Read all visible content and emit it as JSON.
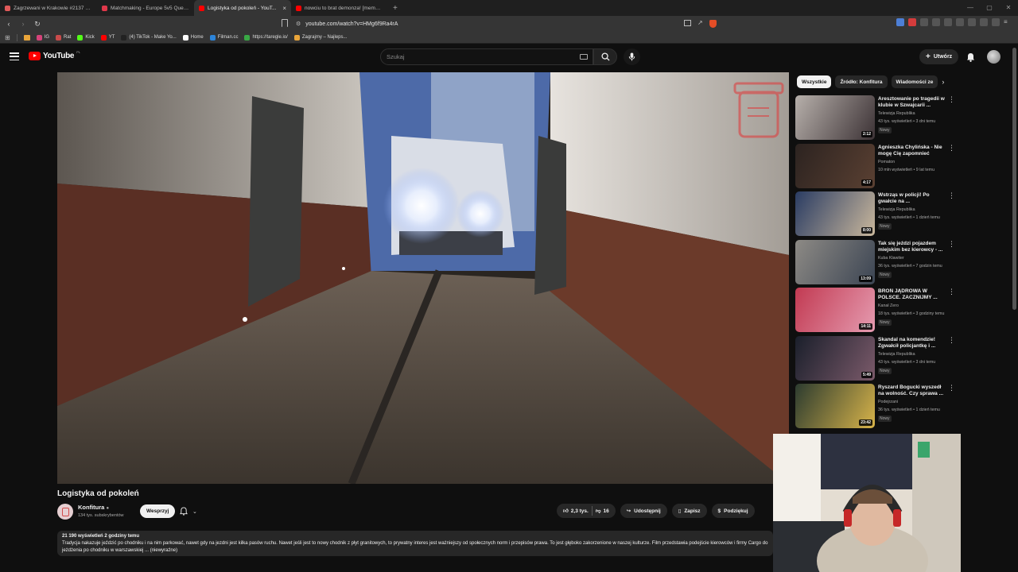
{
  "browser": {
    "tabs": [
      {
        "title": "Zagrzewani w Krakowie #2137 Wa...",
        "favicon_color": "#e05a5a",
        "active": false
      },
      {
        "title": "Matchmaking - Europe 5v5 Queue -",
        "favicon_color": "#e0384a",
        "active": false
      },
      {
        "title": "Logistyka od pokoleń - YouT...",
        "favicon_color": "#ff0000",
        "active": true
      },
      {
        "title": "nowciu to brat demonza! [memmor...",
        "favicon_color": "#ff0000",
        "active": false
      }
    ],
    "url": "youtube.com/watch?v=HMg6f9Ra4rA",
    "bookmarks": [
      {
        "label": "IG",
        "color": "#d6437a"
      },
      {
        "label": "Rat",
        "color": "#c94b4b"
      },
      {
        "label": "Kick",
        "color": "#53fc18"
      },
      {
        "label": "YT",
        "color": "#ff0000"
      },
      {
        "label": "(4) TikTok - Make Yo...",
        "color": "#222222"
      },
      {
        "label": "Home",
        "color": "#ffffff"
      },
      {
        "label": "Filman.cc",
        "color": "#2c84d9"
      },
      {
        "label": "https://taregle.io/",
        "color": "#39a845"
      },
      {
        "label": "Zagrajmy – Najleps...",
        "color": "#e9a53a"
      }
    ]
  },
  "youtube": {
    "logo_text": "YouTube",
    "logo_country": "PL",
    "search_placeholder": "Szukaj",
    "create_label": "Utwórz"
  },
  "video": {
    "title": "Logistyka od pokoleń",
    "channel": "Konfitura",
    "subscribers": "134 tys. subskrybentów",
    "support_label": "Wesprzyj",
    "likes": "2,3 tys.",
    "dislikes": "16",
    "share_label": "Udostępnij",
    "save_label": "Zapisz",
    "thanks_label": "Podziękuj",
    "views_time": "21 190 wyświetleń  2 godziny temu",
    "description": "Tradycja nakazuje jeździć po chodniku i na nim parkować, nawet gdy na jezdni jest kilka pasów ruchu. Nawet jeśli jest to nowy chodnik z płyt granitowych, to prywatny interes jest ważniejszy od społecznych norm i przepisów prawa. To jest głęboko zakorzenione w naszej kulturze. Film przedstawia podejście kierowców i firmy Cargo do jeżdżenia po chodniku w warszawskiej ... (niewyraźne)"
  },
  "chips": [
    "Wszystkie",
    "Źródło: Konfitura",
    "Wiadomości ze"
  ],
  "recommendations": [
    {
      "title": "Aresztowanie po tragedii w klubie w Szwajcarii ...",
      "channel": "Telewizja Republika",
      "meta": "43 tys. wyświetleń • 3 dni temu",
      "badge": "Nowy",
      "duration": "2:12",
      "colors": [
        "#b7b0ab",
        "#3c3235"
      ]
    },
    {
      "title": "Agnieszka Chylińska - Nie mogę Cię zapomnieć",
      "channel": "Pomaton",
      "meta": "10 mln wyświetleń • 9 lat temu",
      "badge": "",
      "duration": "4:17",
      "colors": [
        "#2c2320",
        "#5a4032"
      ]
    },
    {
      "title": "Wstrząs w policji! Po gwałcie na ...",
      "channel": "Telewizja Republika",
      "meta": "43 tys. wyświetleń • 1 dzień temu",
      "badge": "Nowy",
      "duration": "8:00",
      "colors": [
        "#2a3c63",
        "#c9b79c"
      ]
    },
    {
      "title": "Tak się jeździ pojazdem miejskim bez kierowcy - ...",
      "channel": "Kuba Klawiter",
      "meta": "36 tys. wyświetleń • 7 godzin temu",
      "badge": "Nowy",
      "duration": "13:09",
      "colors": [
        "#8d8a85",
        "#3c4553"
      ]
    },
    {
      "title": "BROŃ JĄDROWA W POLSCE. ZACZNIJMY ...",
      "channel": "Kanał Zero",
      "meta": "18 tys. wyświetleń • 3 godziny temu",
      "badge": "Nowy",
      "duration": "14:11",
      "colors": [
        "#c23a52",
        "#e59bb0"
      ]
    },
    {
      "title": "Skandal na komendzie! Zgwałcił policjantkę i ...",
      "channel": "Telewizja Republika",
      "meta": "43 tys. wyświetleń • 3 dni temu",
      "badge": "Nowy",
      "duration": "5:49",
      "colors": [
        "#1a1f2b",
        "#7b5a6a"
      ]
    },
    {
      "title": "Ryszard Bogucki wyszedł na wolność. Czy sprawa ...",
      "channel": "Podejrzani",
      "meta": "36 tys. wyświetleń • 1 dzień temu",
      "badge": "Nowy",
      "duration": "23:42",
      "colors": [
        "#2c3b2f",
        "#d7b34a"
      ]
    }
  ]
}
